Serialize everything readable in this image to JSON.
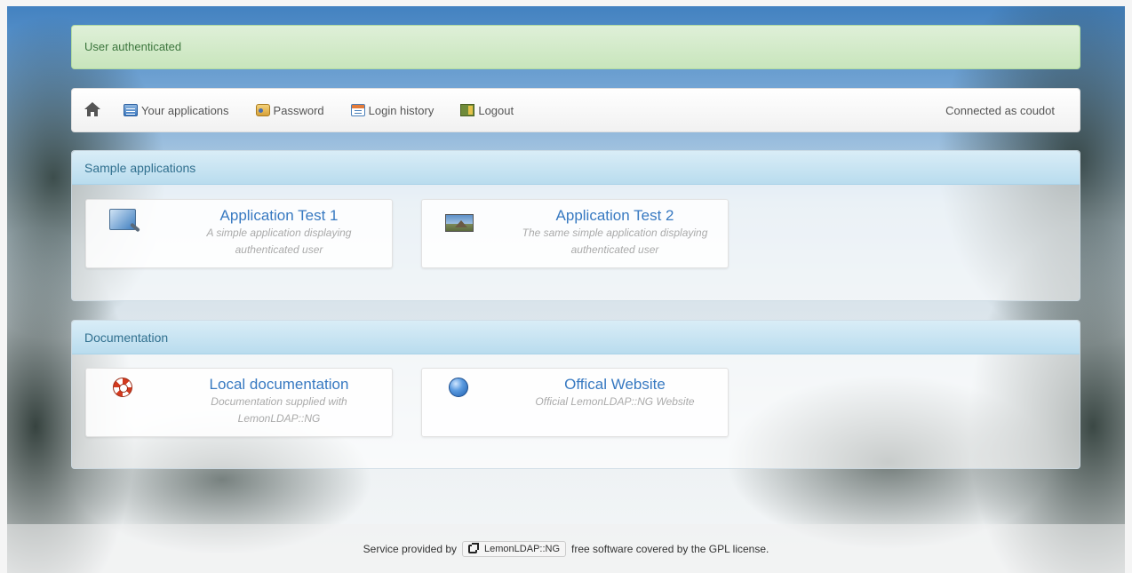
{
  "alert": {
    "message": "User authenticated"
  },
  "navbar": {
    "items": [
      {
        "label": "Your applications",
        "icon": "applications-icon"
      },
      {
        "label": "Password",
        "icon": "password-icon"
      },
      {
        "label": "Login history",
        "icon": "login-history-icon"
      },
      {
        "label": "Logout",
        "icon": "logout-icon"
      }
    ],
    "connected_as": "Connected as coudot"
  },
  "categories": [
    {
      "title": "Sample applications",
      "apps": [
        {
          "title": "Application Test 1",
          "description": "A simple application displaying authenticated user",
          "icon": "magnifier-icon"
        },
        {
          "title": "Application Test 2",
          "description": "The same simple application displaying authenticated user",
          "icon": "landscape-photo-icon"
        }
      ]
    },
    {
      "title": "Documentation",
      "apps": [
        {
          "title": "Local documentation",
          "description": "Documentation supplied with LemonLDAP::NG",
          "icon": "lifebuoy-icon"
        },
        {
          "title": "Offical Website",
          "description": "Official LemonLDAP::NG Website",
          "icon": "globe-icon"
        }
      ]
    }
  ],
  "footer": {
    "prefix": "Service provided by",
    "link_label": "LemonLDAP::NG",
    "suffix": "free software covered by the GPL license."
  },
  "colors": {
    "alert_bg": "#dff0d8",
    "alert_text": "#3c763d",
    "panel_header_bg": "#d9edf7",
    "panel_header_text": "#31708f",
    "app_title": "#3779c1"
  }
}
